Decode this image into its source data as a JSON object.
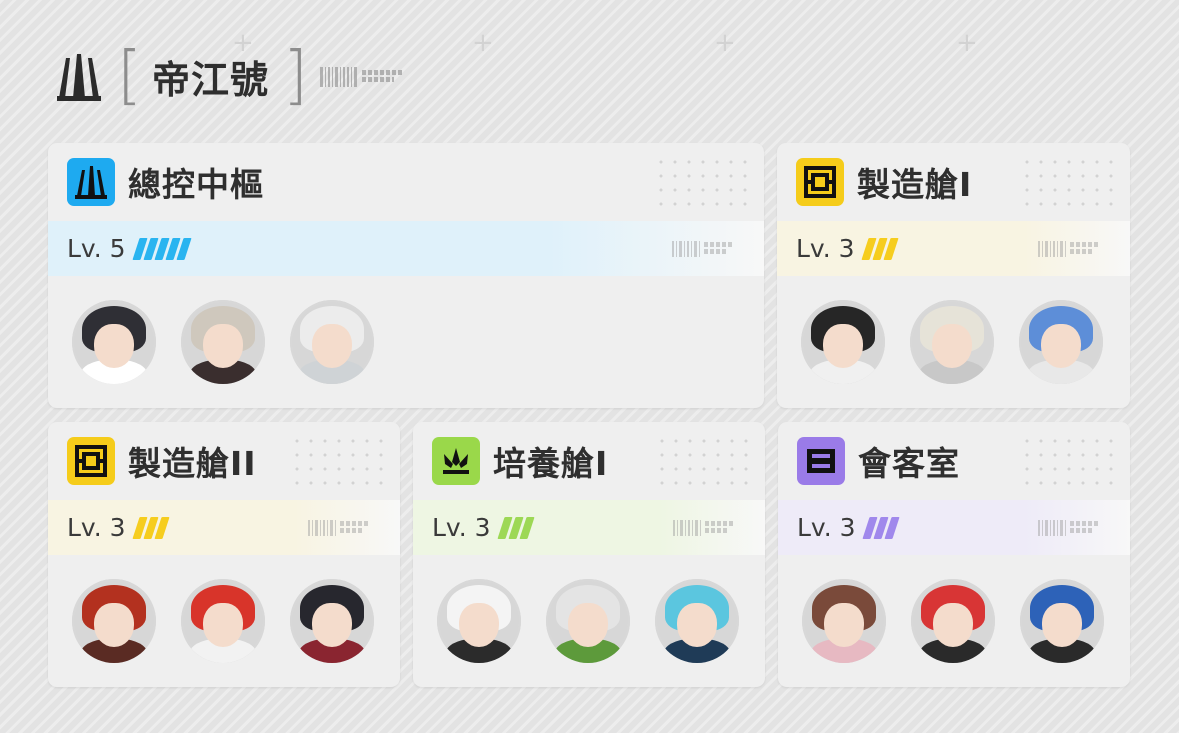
{
  "header": {
    "title": "帝江號",
    "bracket_left": "[",
    "bracket_right": "]",
    "logo_icon": "triple-tower-logo-icon"
  },
  "rooms": [
    {
      "name": "總控中樞",
      "icon": "control-tower-icon",
      "icon_color": "#1eaaf0",
      "level": "Lv. 5",
      "level_value": 5,
      "stripe_color": "#29b4f0",
      "band_color": "#dff1fa",
      "characters": [
        {
          "name": "character-avatar-1",
          "hair": "#2f2f35",
          "body": "#ffffff",
          "bg": "#d7d7d7"
        },
        {
          "name": "character-avatar-2",
          "hair": "#cfc8bd",
          "body": "#3a2e2e",
          "bg": "#d7d7d7"
        },
        {
          "name": "character-avatar-3",
          "hair": "#ececec",
          "body": "#cfd3d6",
          "bg": "#d7d7d7"
        }
      ]
    },
    {
      "name": "製造艙I",
      "icon": "manufacture-icon",
      "icon_color": "#f5cc1a",
      "level": "Lv. 3",
      "level_value": 3,
      "stripe_color": "#f6cd1e",
      "band_color": "#f8f4e2",
      "characters": [
        {
          "name": "character-avatar-4",
          "hair": "#262626",
          "body": "#f0f0f0",
          "bg": "#d7d7d7"
        },
        {
          "name": "character-avatar-5",
          "hair": "#e6e3d8",
          "body": "#c8c8c8",
          "bg": "#d7d7d7"
        },
        {
          "name": "character-avatar-6",
          "hair": "#5d8ed8",
          "body": "#e8e8e8",
          "bg": "#d7d7d7"
        }
      ]
    },
    {
      "name": "製造艙II",
      "icon": "manufacture-icon",
      "icon_color": "#f5cc1a",
      "level": "Lv. 3",
      "level_value": 3,
      "stripe_color": "#f6cd1e",
      "band_color": "#f8f4e2",
      "characters": [
        {
          "name": "character-avatar-7",
          "hair": "#b3311f",
          "body": "#5a2b23",
          "bg": "#d7d7d7"
        },
        {
          "name": "character-avatar-8",
          "hair": "#d8342a",
          "body": "#f2f2f2",
          "bg": "#d7d7d7"
        },
        {
          "name": "character-avatar-9",
          "hair": "#27272e",
          "body": "#8a2530",
          "bg": "#d7d7d7"
        }
      ]
    },
    {
      "name": "培養艙I",
      "icon": "cultivation-icon",
      "icon_color": "#9ad84a",
      "level": "Lv. 3",
      "level_value": 3,
      "stripe_color": "#9dd855",
      "band_color": "#eef6e3",
      "characters": [
        {
          "name": "character-avatar-10",
          "hair": "#f4f4f4",
          "body": "#2b2b2b",
          "bg": "#d7d7d7"
        },
        {
          "name": "character-avatar-11",
          "hair": "#e4e4e4",
          "body": "#5d9a3b",
          "bg": "#d7d7d7"
        },
        {
          "name": "character-avatar-12",
          "hair": "#5bc6df",
          "body": "#1f3b57",
          "bg": "#d7d7d7"
        }
      ]
    },
    {
      "name": "會客室",
      "icon": "reception-icon",
      "icon_color": "#9a7be8",
      "level": "Lv. 3",
      "level_value": 3,
      "stripe_color": "#a088ec",
      "band_color": "#eeebf8",
      "characters": [
        {
          "name": "character-avatar-13",
          "hair": "#7a4a3a",
          "body": "#e7b9c2",
          "bg": "#d7d7d7"
        },
        {
          "name": "character-avatar-14",
          "hair": "#d83535",
          "body": "#2a2a2a",
          "bg": "#d7d7d7"
        },
        {
          "name": "character-avatar-15",
          "hair": "#2d62b8",
          "body": "#2a2a2a",
          "bg": "#d7d7d7"
        }
      ]
    }
  ]
}
